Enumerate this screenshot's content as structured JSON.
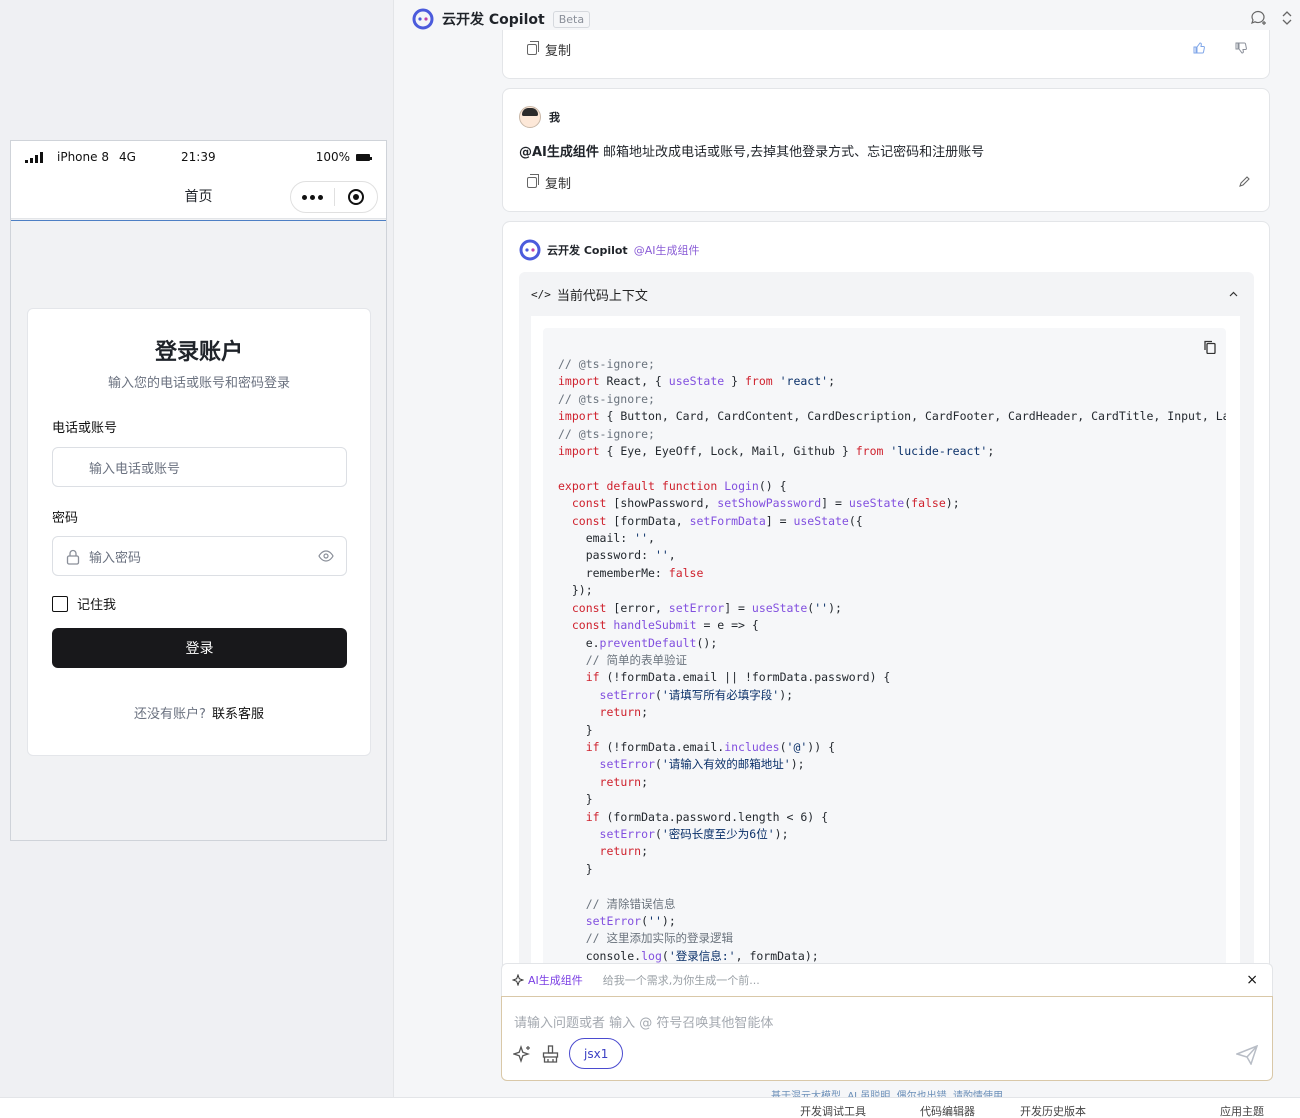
{
  "phone": {
    "device": "iPhone 8",
    "network": "4G",
    "time": "21:39",
    "battery": "100%",
    "nav_title": "首页",
    "login": {
      "title": "登录账户",
      "subtitle": "输入您的电话或账号和密码登录",
      "account_label": "电话或账号",
      "account_placeholder": "输入电话或账号",
      "password_label": "密码",
      "password_placeholder": "输入密码",
      "remember_label": "记住我",
      "submit_label": "登录",
      "signup_prompt": "还没有账户?",
      "signup_link": "联系客服"
    }
  },
  "copilot": {
    "title": "云开发 Copilot",
    "badge": "Beta",
    "prev_copy_label": "复制",
    "user_message": {
      "author": "我",
      "mention": "@AI生成组件",
      "text": "邮箱地址改成电话或账号,去掉其他登录方式、忘记密码和注册账号",
      "copy_label": "复制"
    },
    "assistant_message": {
      "author": "云开发 Copilot",
      "mention": "@AI生成组件",
      "context_title": "当前代码上下文"
    },
    "agent_bar": {
      "name": "AI生成组件",
      "hint": "给我一个需求,为你生成一个前...",
      "close": "×"
    },
    "composer": {
      "placeholder": "请输入问题或者 输入 @ 符号召唤其他智能体",
      "tag": "jsx1"
    },
    "footer_note": "基于混元大模型, AI 虽聪明, 偶尔也出错, 请酌情使用"
  },
  "code_lines": [
    "// @ts-ignore;",
    "import React, { useState } from 'react';",
    "// @ts-ignore;",
    "import { Button, Card, CardContent, CardDescription, CardFooter, CardHeader, CardTitle, Input, Label, ",
    "// @ts-ignore;",
    "import { Eye, EyeOff, Lock, Mail, Github } from 'lucide-react';",
    "",
    "export default function Login() {",
    "  const [showPassword, setShowPassword] = useState(false);",
    "  const [formData, setFormData] = useState({",
    "    email: '',",
    "    password: '',",
    "    rememberMe: false",
    "  });",
    "  const [error, setError] = useState('');",
    "  const handleSubmit = e => {",
    "    e.preventDefault();",
    "    // 简单的表单验证",
    "    if (!formData.email || !formData.password) {",
    "      setError('请填写所有必填字段');",
    "      return;",
    "    }",
    "    if (!formData.email.includes('@')) {",
    "      setError('请输入有效的邮箱地址');",
    "      return;",
    "    }",
    "    if (formData.password.length < 6) {",
    "      setError('密码长度至少为6位');",
    "      return;",
    "    }",
    "",
    "    // 清除错误信息",
    "    setError('');",
    "    // 这里添加实际的登录逻辑",
    "    console.log('登录信息:', formData);"
  ],
  "bottom_bar": {
    "items": [
      "开发调试工具",
      "代码编辑器",
      "开发历史版本",
      "应用主题"
    ]
  }
}
